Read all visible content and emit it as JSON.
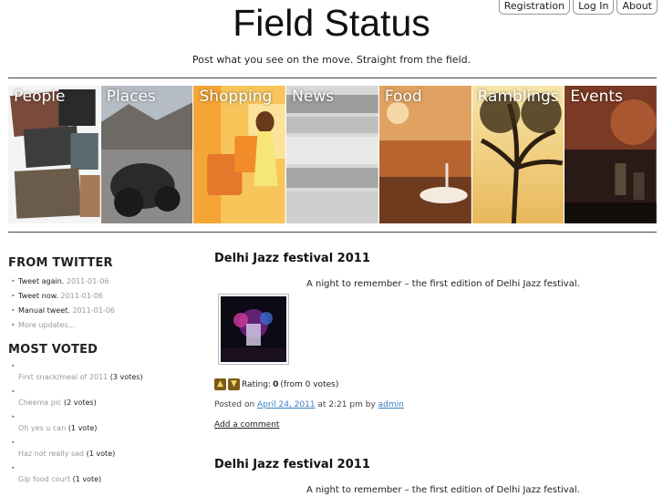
{
  "nav": {
    "registration": "Registration",
    "login": "Log In",
    "about": "About"
  },
  "site": {
    "title": "Field Status",
    "tagline": "Post what you see on the move. Straight from the field."
  },
  "categories": [
    "People",
    "Places",
    "Shopping",
    "News",
    "Food",
    "Ramblings",
    "Events"
  ],
  "sidebar": {
    "twitter_heading": "FROM TWITTER",
    "tweets": [
      {
        "text": "Tweet again.",
        "date": "2011-01-06"
      },
      {
        "text": "Tweet now.",
        "date": "2011-01-06"
      },
      {
        "text": "Manual tweet.",
        "date": "2011-01-06"
      }
    ],
    "more_updates": "More updates...",
    "most_voted_heading": "MOST VOTED",
    "most_voted": [
      {
        "title": "First snack/meal of 2011",
        "votes": "(3 votes)"
      },
      {
        "title": "Cheema pic",
        "votes": "(2 votes)"
      },
      {
        "title": "Oh yes u can",
        "votes": "(1 vote)"
      },
      {
        "title": "Haz not really sad",
        "votes": "(1 vote)"
      },
      {
        "title": "Gip food court",
        "votes": "(1 vote)"
      }
    ]
  },
  "posts": [
    {
      "title": "Delhi Jazz festival 2011",
      "excerpt": "A night to remember – the first edition of Delhi Jazz festival.",
      "rating_label": "Rating:",
      "rating_value": "0",
      "rating_note": "(from 0 votes)",
      "posted_on": "Posted on",
      "date": "April 24, 2011",
      "at": "at 2:21 pm by",
      "author": "admin",
      "add_comment": "Add a comment"
    },
    {
      "title": "Delhi Jazz festival 2011",
      "excerpt": "A night to remember – the first edition of Delhi Jazz festival."
    }
  ]
}
